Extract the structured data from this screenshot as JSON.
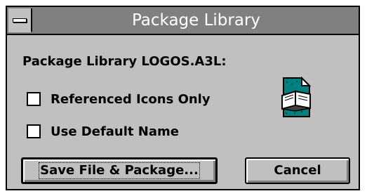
{
  "window": {
    "title": "Package Library"
  },
  "library": {
    "label": "Package Library LOGOS.A3L:"
  },
  "options": [
    {
      "label": "Referenced Icons Only",
      "checked": false
    },
    {
      "label": "Use Default Name",
      "checked": false
    }
  ],
  "icon": {
    "name": "package-library-book-icon"
  },
  "buttons": {
    "save_label": "Save File & Package...",
    "cancel_label": "Cancel"
  },
  "colors": {
    "dialog_face": "#c0c0c0",
    "title_bar": "#808080",
    "title_text": "#ffffff",
    "icon_teal": "#008080"
  }
}
